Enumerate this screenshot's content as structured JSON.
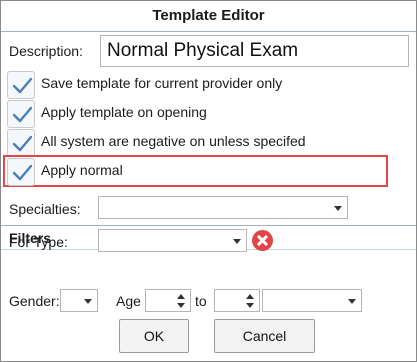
{
  "window": {
    "title": "Template Editor"
  },
  "description": {
    "label": "Description:",
    "value": "Normal Physical Exam"
  },
  "options": [
    {
      "label": "Save template for current provider only",
      "checked": true
    },
    {
      "label": "Apply template on opening",
      "checked": true
    },
    {
      "label": "All system are negative on unless specifed",
      "checked": true
    },
    {
      "label": "Apply normal",
      "checked": true,
      "highlighted": true
    }
  ],
  "specialties": {
    "label": "Specialties:",
    "value": ""
  },
  "filters": {
    "heading": "Filters",
    "for_type": {
      "label": "For Type:",
      "value": ""
    },
    "gender": {
      "label": "Gender:",
      "value": ""
    },
    "age": {
      "label": "Age",
      "from": "",
      "to_label": "to",
      "to": "",
      "unit": ""
    }
  },
  "buttons": {
    "ok": "OK",
    "cancel": "Cancel"
  },
  "colors": {
    "highlight": "#e2464b",
    "check": "#4a7fb5",
    "clear": "#e0454a",
    "divider": "#9fb3c8"
  }
}
